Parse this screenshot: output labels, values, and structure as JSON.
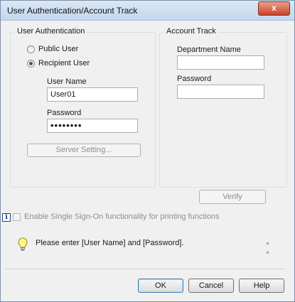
{
  "window": {
    "title": "User Authentication/Account Track",
    "close_glyph": "x"
  },
  "user_auth": {
    "legend": "User Authentication",
    "public_user_label": "Public User",
    "recipient_user_label": "Recipient User",
    "selected": "Recipient User",
    "user_name_label": "User Name",
    "user_name_value": "User01",
    "password_label": "Password",
    "password_value": "••••••••",
    "server_setting_label": "Server Setting..."
  },
  "account_track": {
    "legend": "Account Track",
    "department_name_label": "Department Name",
    "department_name_value": "",
    "password_label": "Password",
    "password_value": ""
  },
  "verify_label": "Verify",
  "sso": {
    "info_glyph": "i",
    "label": "Enable Single Sign-On functionality for printing functions",
    "checked": false
  },
  "message": {
    "icon": "lightbulb-icon",
    "text": "Please enter [User Name] and [Password]."
  },
  "buttons": {
    "ok": "OK",
    "cancel": "Cancel",
    "help": "Help"
  }
}
